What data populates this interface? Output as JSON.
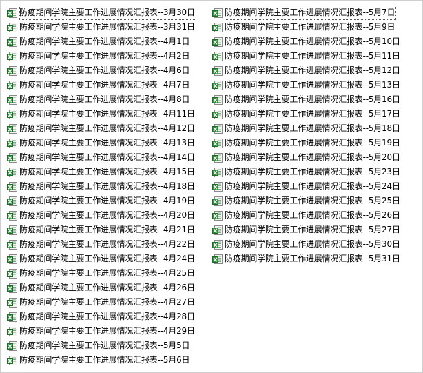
{
  "icon": "excel-spreadsheet-icon",
  "colors": {
    "icon_green": "#2f8f3a",
    "icon_sheet": "#f4f4f4",
    "border": "#cfcfcf"
  },
  "left_items": [
    "防疫期间学院主要工作进展情况汇报表--3月30日",
    "防疫期间学院主要工作进展情况汇报表--3月31日",
    "防疫期间学院主要工作进展情况汇报表--4月1日",
    "防疫期间学院主要工作进展情况汇报表--4月2日",
    "防疫期间学院主要工作进展情况汇报表--4月6日",
    "防疫期间学院主要工作进展情况汇报表--4月7日",
    "防疫期间学院主要工作进展情况汇报表--4月8日",
    "防疫期间学院主要工作进展情况汇报表--4月11日",
    "防疫期间学院主要工作进展情况汇报表--4月12日",
    "防疫期间学院主要工作进展情况汇报表--4月13日",
    "防疫期间学院主要工作进展情况汇报表--4月14日",
    "防疫期间学院主要工作进展情况汇报表--4月15日",
    "防疫期间学院主要工作进展情况汇报表--4月18日",
    "防疫期间学院主要工作进展情况汇报表--4月19日",
    "防疫期间学院主要工作进展情况汇报表--4月20日",
    "防疫期间学院主要工作进展情况汇报表--4月21日",
    "防疫期间学院主要工作进展情况汇报表--4月22日",
    "防疫期间学院主要工作进展情况汇报表--4月24日",
    "防疫期间学院主要工作进展情况汇报表--4月25日",
    "防疫期间学院主要工作进展情况汇报表--4月26日",
    "防疫期间学院主要工作进展情况汇报表--4月27日",
    "防疫期间学院主要工作进展情况汇报表--4月28日",
    "防疫期间学院主要工作进展情况汇报表--4月29日",
    "防疫期间学院主要工作进展情况汇报表--5月5日",
    "防疫期间学院主要工作进展情况汇报表--5月6日"
  ],
  "right_items": [
    "防疫期间学院主要工作进展情况汇报表--5月7日",
    "防疫期间学院主要工作进展情况汇报表--5月9日",
    "防疫期间学院主要工作进展情况汇报表--5月10日",
    "防疫期间学院主要工作进展情况汇报表--5月11日",
    "防疫期间学院主要工作进展情况汇报表--5月12日",
    "防疫期间学院主要工作进展情况汇报表--5月13日",
    "防疫期间学院主要工作进展情况汇报表--5月16日",
    "防疫期间学院主要工作进展情况汇报表--5月17日",
    "防疫期间学院主要工作进展情况汇报表--5月18日",
    "防疫期间学院主要工作进展情况汇报表--5月19日",
    "防疫期间学院主要工作进展情况汇报表--5月20日",
    "防疫期间学院主要工作进展情况汇报表--5月23日",
    "防疫期间学院主要工作进展情况汇报表--5月24日",
    "防疫期间学院主要工作进展情况汇报表--5月25日",
    "防疫期间学院主要工作进展情况汇报表--5月26日",
    "防疫期间学院主要工作进展情况汇报表--5月27日",
    "防疫期间学院主要工作进展情况汇报表--5月30日",
    "防疫期间学院主要工作进展情况汇报表--5月31日"
  ]
}
